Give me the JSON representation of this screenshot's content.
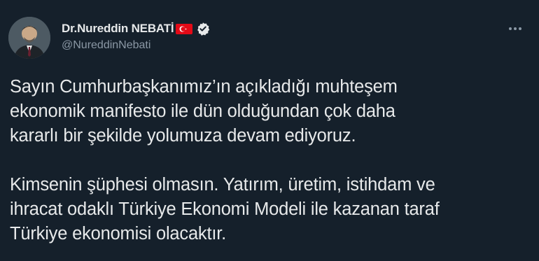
{
  "author": {
    "display_name": "Dr.Nureddin NEBATİ",
    "handle": "@NureddinNebati",
    "flag_icon": "turkey-flag-icon",
    "verified_icon": "verified-badge-icon"
  },
  "tweet": {
    "paragraph1": [
      "Sayın Cumhurbaşkanımız’ın açıkladığı muhteşem",
      "ekonomik manifesto ile dün olduğundan çok daha",
      "kararlı bir şekilde yolumuza devam ediyoruz."
    ],
    "paragraph2": [
      "Kimsenin şüphesi olmasın. Yatırım, üretim, istihdam ve",
      "ihracat odaklı Türkiye Ekonomi Modeli ile kazanan taraf",
      "Türkiye ekonomisi olacaktır."
    ]
  },
  "colors": {
    "background": "#15202b",
    "text": "#e7e9ea",
    "secondary_text": "#8b98a5",
    "flag_red": "#e30a17"
  },
  "icons": {
    "more": "more-options-icon"
  }
}
